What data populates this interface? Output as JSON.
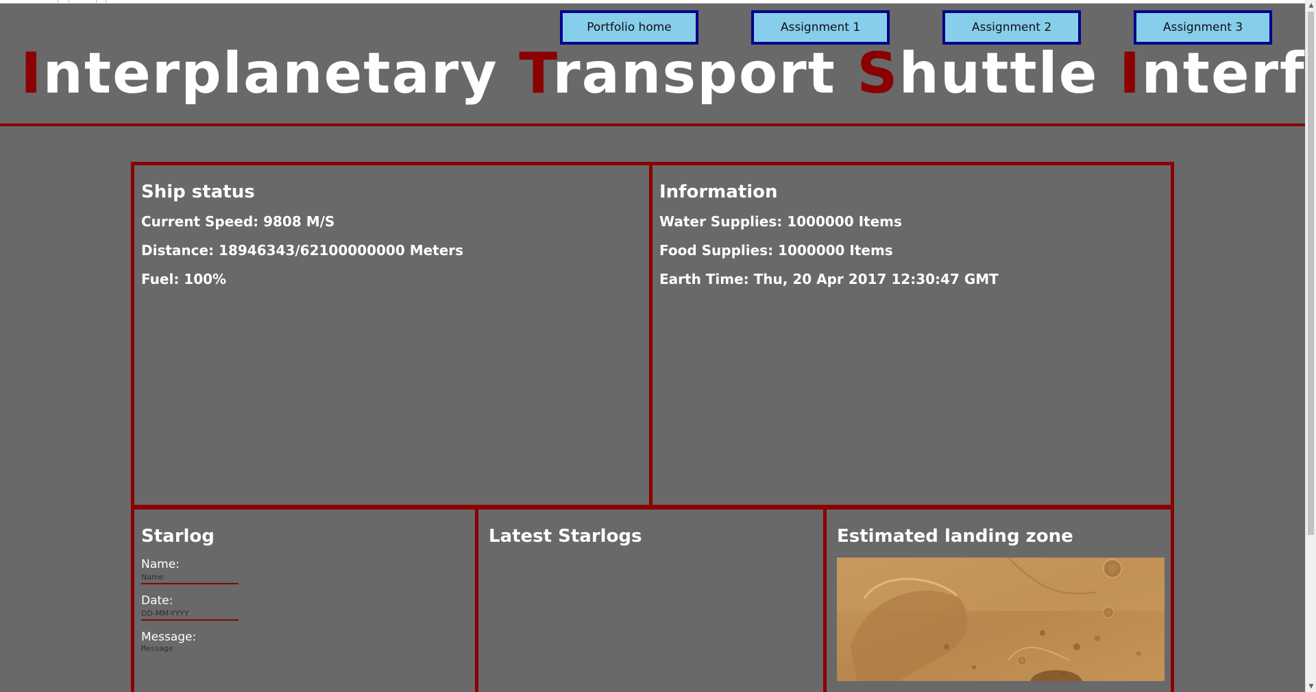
{
  "nav": {
    "buttons": [
      {
        "label": "Portfolio home"
      },
      {
        "label": "Assignment 1"
      },
      {
        "label": "Assignment 2"
      },
      {
        "label": "Assignment 3"
      }
    ]
  },
  "header": {
    "title_words": [
      {
        "initial": "I",
        "rest": "nterplanetary"
      },
      {
        "initial": "T",
        "rest": "ransport"
      },
      {
        "initial": "S",
        "rest": "huttle"
      },
      {
        "initial": "I",
        "rest": "nterface"
      }
    ],
    "accent_color": "#8b0000"
  },
  "ship_status": {
    "heading": "Ship status",
    "speed": "Current Speed: 9808 M/S",
    "distance": "Distance: 18946343/62100000000 Meters",
    "fuel": "Fuel: 100%"
  },
  "information": {
    "heading": "Information",
    "water": "Water Supplies: 1000000 Items",
    "food": "Food Supplies: 1000000 Items",
    "earth_time": "Earth Time: Thu, 20 Apr 2017 12:30:47 GMT"
  },
  "starlog": {
    "heading": "Starlog",
    "name_label": "Name:",
    "name_placeholder": "Name",
    "date_label": "Date:",
    "date_placeholder": "DD-MM-YYYY",
    "message_label": "Message:",
    "message_placeholder": "Message"
  },
  "latest_starlogs": {
    "heading": "Latest Starlogs"
  },
  "landing_zone": {
    "heading": "Estimated landing zone",
    "image_icon": "mars-crater-terrain-image"
  },
  "colors": {
    "background": "#696969",
    "border": "#8b0000",
    "button_fill": "#87ceeb",
    "button_border": "#00008b"
  }
}
